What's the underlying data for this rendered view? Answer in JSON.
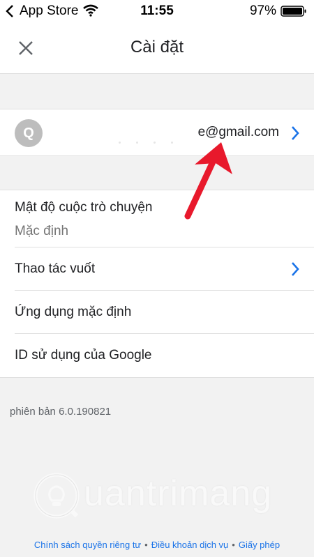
{
  "status_bar": {
    "app_back_label": "App Store",
    "time": "11:55",
    "battery_pct": "97%"
  },
  "header": {
    "title": "Cài đặt",
    "close_icon": "close-icon"
  },
  "account": {
    "avatar_initial": "Q",
    "email_visible": "e@gmail.com"
  },
  "settings": {
    "items": [
      {
        "label": "Mật độ cuộc trò chuyện",
        "value": "Mặc định"
      },
      {
        "label": "Thao tác vuốt"
      },
      {
        "label": "Ứng dụng mặc định"
      },
      {
        "label": "ID sử dụng của Google"
      }
    ]
  },
  "version": "phiên bản 6.0.190821",
  "footer": {
    "links": [
      "Chính sách quyền riêng tư",
      "Điều khoản dịch vụ",
      "Giấy phép"
    ],
    "separator": "•"
  },
  "watermark": {
    "text": "uantrimang"
  },
  "colors": {
    "accent": "#1a73e8",
    "annotation_arrow": "#e8192c"
  }
}
